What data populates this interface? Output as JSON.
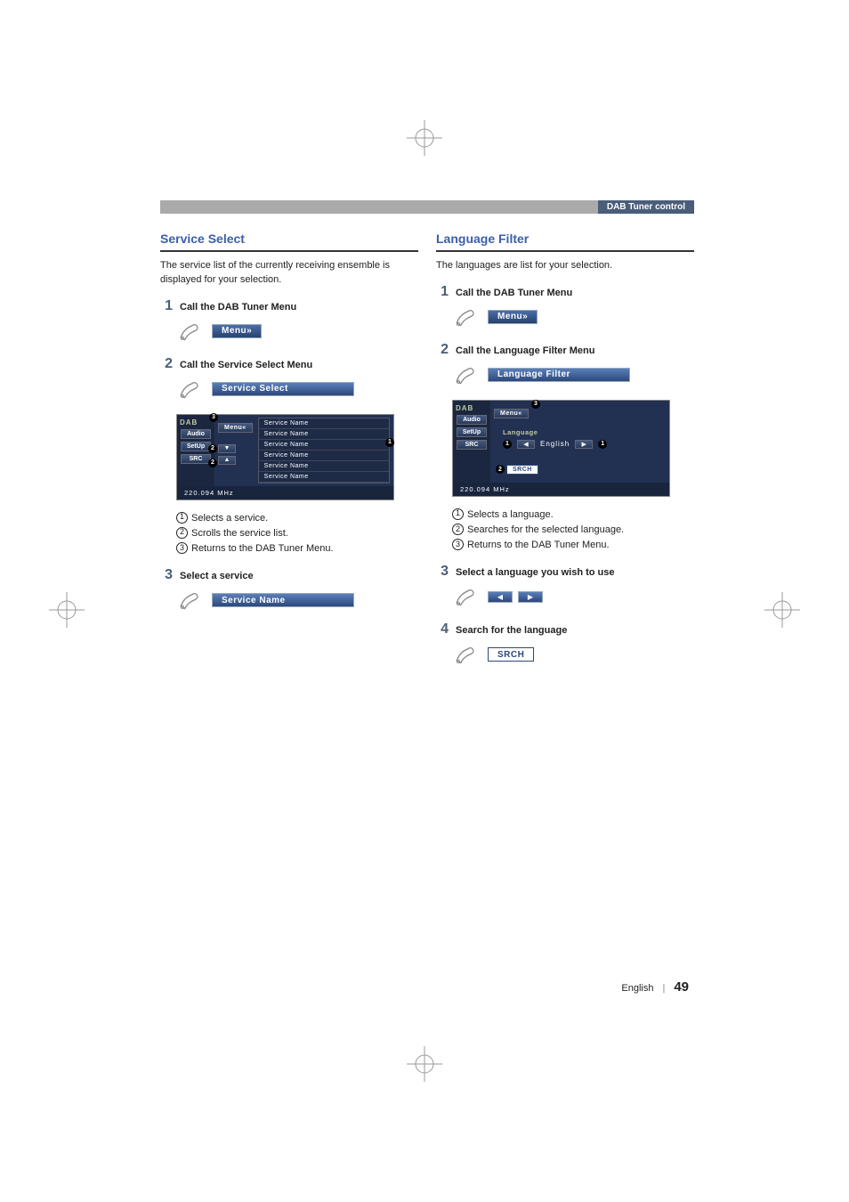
{
  "header": {
    "tab": "DAB Tuner control"
  },
  "left": {
    "title": "Service Select",
    "lead": "The service list of the currently receiving ensemble is displayed for your selection.",
    "steps": {
      "s1": {
        "num": "1",
        "text": "Call the DAB Tuner Menu",
        "button": "Menu»"
      },
      "s2": {
        "num": "2",
        "text": "Call the Service Select Menu",
        "button": "Service Select"
      },
      "s3": {
        "num": "3",
        "text": "Select a service",
        "button": "Service Name"
      }
    },
    "screen": {
      "dab": "DAB",
      "menu": "Menu«",
      "sidebar": {
        "audio": "Audio",
        "setup": "SetUp",
        "src": "SRC"
      },
      "services": [
        "Service Name",
        "Service Name",
        "Service Name",
        "Service Name",
        "Service Name",
        "Service Name"
      ],
      "freq": "220.094 MHz"
    },
    "legend": {
      "l1": "Selects a service.",
      "l2": "Scrolls the service list.",
      "l3": "Returns to the DAB Tuner Menu."
    }
  },
  "right": {
    "title": "Language Filter",
    "lead": "The languages are list for your selection.",
    "steps": {
      "s1": {
        "num": "1",
        "text": "Call the DAB Tuner Menu",
        "button": "Menu»"
      },
      "s2": {
        "num": "2",
        "text": "Call the Language Filter Menu",
        "button": "Language Filter"
      },
      "s3": {
        "num": "3",
        "text": "Select a language you wish to use"
      },
      "s4": {
        "num": "4",
        "text": "Search for the language",
        "button": "SRCH"
      }
    },
    "screen": {
      "dab": "DAB",
      "menu": "Menu«",
      "sidebar": {
        "audio": "Audio",
        "setup": "SetUp",
        "src": "SRC"
      },
      "langLabel": "Language",
      "langValue": "English",
      "srch": "SRCH",
      "freq": "220.094 MHz"
    },
    "legend": {
      "l1": "Selects a language.",
      "l2": "Searches for the selected language.",
      "l3": "Returns to the DAB Tuner Menu."
    }
  },
  "footer": {
    "lang": "English",
    "page": "49"
  }
}
